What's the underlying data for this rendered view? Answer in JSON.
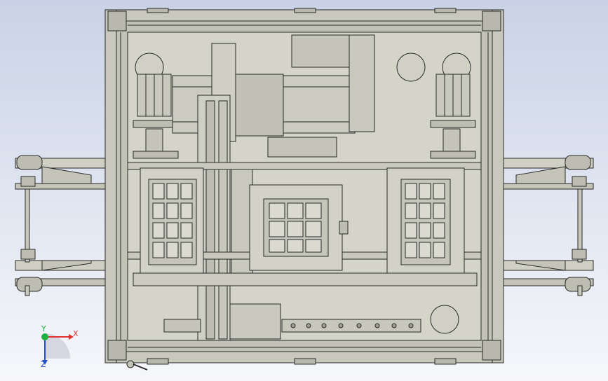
{
  "viewport": {
    "background_top": "#c9d2e6",
    "background_bottom": "#f6f7fb"
  },
  "colors": {
    "metal_light": "#dadad0",
    "metal_mid": "#c7c7bb",
    "metal_dark": "#9d9d92",
    "outline": "#2a2a2a",
    "triad_x": "#e03030",
    "triad_y": "#20b040",
    "triad_z": "#2050d0"
  },
  "triad": {
    "x_label": "X",
    "y_label": "Y",
    "z_label": "Z"
  }
}
